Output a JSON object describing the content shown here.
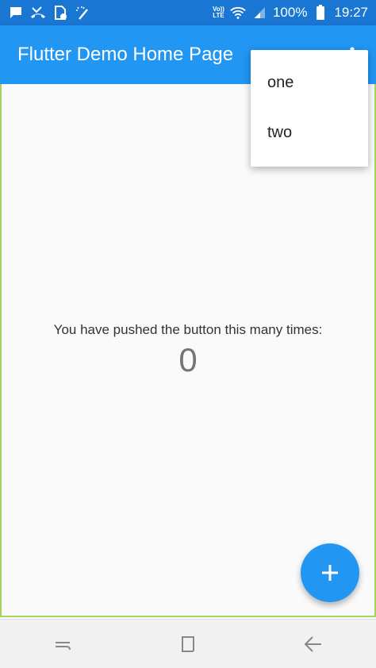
{
  "status_bar": {
    "icons": [
      "message-icon",
      "missed-call-icon",
      "sim-alert-icon",
      "magic-wand-icon",
      "volte-icon",
      "wifi-icon",
      "signal-icon",
      "battery-icon"
    ],
    "volte_line1": "Vo))",
    "volte_line2": "LTE",
    "battery_percent": "100%",
    "time": "19:27"
  },
  "app_bar": {
    "title": "Flutter Demo Home Page",
    "overflow_icon": "more-vert-icon"
  },
  "main": {
    "message": "You have pushed the button this many times:",
    "counter": "0"
  },
  "popup_menu": {
    "items": [
      {
        "label": "one"
      },
      {
        "label": "two"
      }
    ]
  },
  "fab": {
    "icon": "add-icon"
  },
  "nav_bar": {
    "buttons": [
      "recent-apps-icon",
      "home-icon",
      "back-icon"
    ]
  },
  "colors": {
    "status_bar": "#1976d2",
    "app_bar": "#2196f3",
    "fab": "#2196f3",
    "frame_border": "#a5d65a",
    "background": "#fafafa"
  }
}
